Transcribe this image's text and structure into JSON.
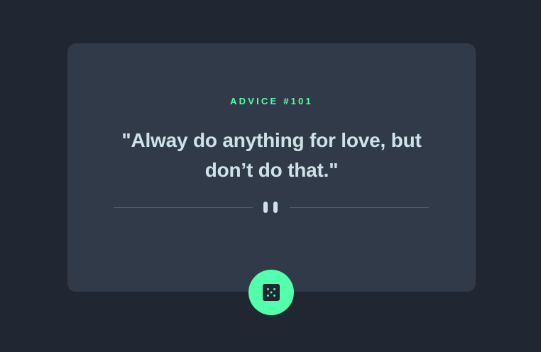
{
  "advice": {
    "id_label": "ADVICE #101",
    "quote": "\"Alway do anything for love, but don’t do that.\""
  },
  "icons": {
    "divider": "pause-icon",
    "button": "dice-icon"
  },
  "colors": {
    "background": "#202632",
    "card": "#313a48",
    "accent": "#53ffaa",
    "text": "#cee3e9",
    "divider": "#4f5d74"
  }
}
